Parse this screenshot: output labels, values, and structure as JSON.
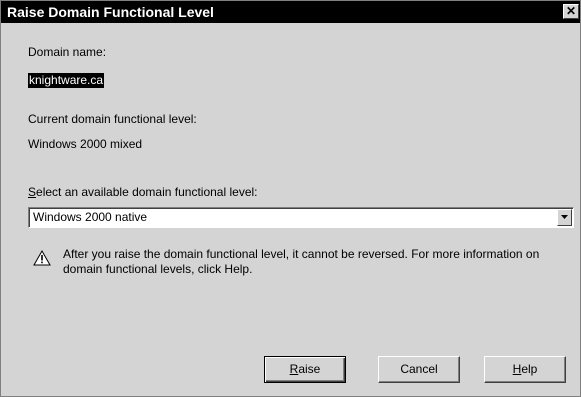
{
  "window": {
    "title": "Raise Domain Functional Level",
    "close_glyph": "✕"
  },
  "domain_name": {
    "label": "Domain name:",
    "value": "knightware.ca"
  },
  "current_level": {
    "label": "Current domain functional level:",
    "value": "Windows 2000 mixed"
  },
  "select_level": {
    "label_accel": "S",
    "label_rest": "elect an available domain functional level:",
    "selected_value": "Windows 2000 native"
  },
  "warning": {
    "icon": "warning-icon",
    "text": "After you raise the domain functional level, it cannot be reversed. For more information on domain functional levels, click Help."
  },
  "buttons": {
    "raise_accel": "R",
    "raise_rest": "aise",
    "cancel": "Cancel",
    "help_accel": "H",
    "help_rest": "elp"
  }
}
